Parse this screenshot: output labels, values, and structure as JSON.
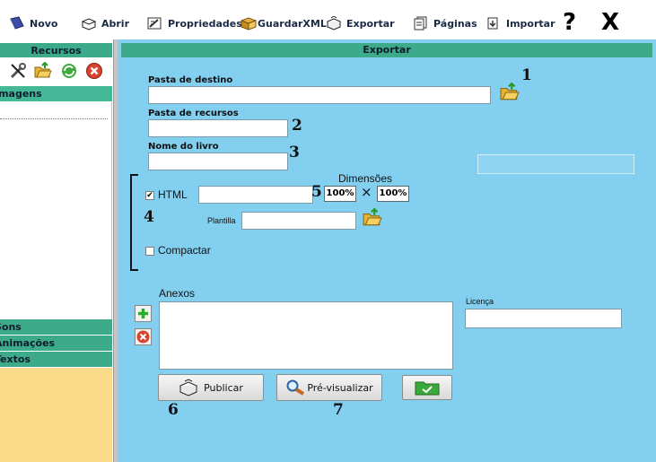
{
  "toolbar": {
    "novo": "Novo",
    "abrir": "Abrir",
    "propriedades": "Propriedades",
    "guardarxml": "GuardarXML",
    "exportar": "Exportar",
    "paginas": "Páginas",
    "importar": "Importar",
    "help": "?",
    "close": "X"
  },
  "left": {
    "recursos": "Recursos",
    "imagens": "Imagens",
    "sons": "Sons",
    "animacoes": "Animações",
    "textos": "Textos"
  },
  "main": {
    "header": "Exportar",
    "pasta_destino_label": "Pasta de destino",
    "pasta_destino_value": "",
    "pasta_recursos_label": "Pasta de recursos",
    "pasta_recursos_value": "",
    "nome_livro_label": "Nome do livro",
    "nome_livro_value": "",
    "dimensoes_label": "Dimensões",
    "html_label": "HTML",
    "html_checked": true,
    "html_value": "",
    "width_pct": "100%",
    "times": "×",
    "height_pct": "100%",
    "plantilla_label": "Plantilla",
    "plantilla_value": "",
    "compactar_label": "Compactar",
    "compactar_checked": false,
    "anexos_label": "Anexos",
    "licenca_label": "Licença",
    "licenca_value": "",
    "publicar": "Publicar",
    "pre_visualizar": "Pré-visualizar"
  },
  "annotations": [
    "1",
    "2",
    "3",
    "4",
    "5",
    "6",
    "7"
  ],
  "colors": {
    "main_bg": "#82cff0",
    "header_green": "#3daa8a",
    "left_yellow": "#fbdb8a"
  }
}
